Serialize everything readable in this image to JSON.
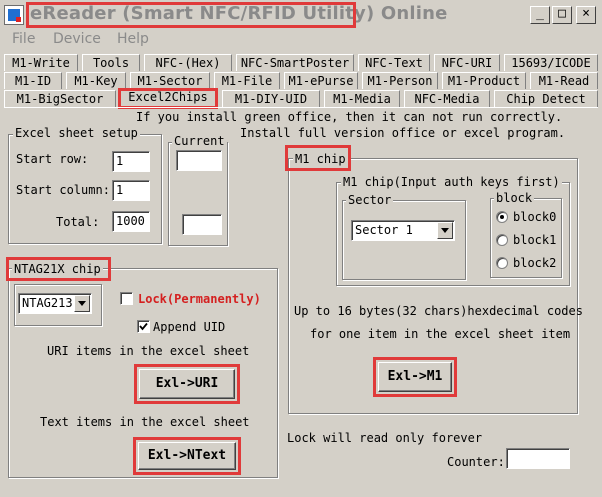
{
  "window": {
    "title": "eReader (Smart NFC/RFID Utility)",
    "title_suffix": " Online",
    "minimize_glyph": "_",
    "maximize_glyph": "□",
    "close_glyph": "×"
  },
  "menu": [
    "File",
    "Device",
    "Help"
  ],
  "tabs": {
    "row1": [
      "M1-Write",
      "Tools",
      "NFC-(Hex)",
      "NFC-SmartPoster",
      "NFC-Text",
      "NFC-URI",
      "15693/ICODE"
    ],
    "row2": [
      "M1-ID",
      "M1-Key",
      "M1-Sector",
      "M1-File",
      "M1-ePurse",
      "M1-Person",
      "M1-Product",
      "M1-Read"
    ],
    "row3": [
      "M1-BigSector",
      "Excel2Chips",
      "M1-DIY-UID",
      "M1-Media",
      "NFC-Media",
      "Chip Detect"
    ]
  },
  "notice": {
    "line1": "If you install green office, then it can not run correctly.",
    "line2": "Install full version office or excel program."
  },
  "excel_setup": {
    "title": "Excel sheet setup",
    "start_row_label": "Start row:",
    "start_row_value": "1",
    "start_column_label": "Start column:",
    "start_column_value": "1",
    "total_label": "Total:",
    "total_value": "1000"
  },
  "current": {
    "title": "Current",
    "value1": "",
    "value2": ""
  },
  "ntag": {
    "title": "NTAG21X chip",
    "chip_type": "NTAG213",
    "lock_label": "Lock(Permanently)",
    "lock_checked": false,
    "append_uid_label": "Append UID",
    "append_uid_checked": true,
    "uri_items_label": "URI items in the excel sheet",
    "exl_uri_button": "Exl->URI",
    "text_items_label": "Text items in the excel sheet",
    "exl_ntext_button": "Exl->NText"
  },
  "m1": {
    "title": "M1 chip",
    "inner_title": "M1 chip(Input auth keys first)",
    "sector_title": "Sector",
    "sector_value": "Sector 1",
    "block_title": "block",
    "blocks": [
      "block0",
      "block1",
      "block2"
    ],
    "selected_block": 0,
    "desc_line1": "Up to 16 bytes(32 chars)hexdecimal codes",
    "desc_line2": "for one item in the excel sheet item",
    "exl_m1_button": "Exl->M1"
  },
  "footer": {
    "lock_note": "Lock will read only forever",
    "counter_label": "Counter:",
    "counter_value": ""
  },
  "colors": {
    "highlight_red": "#e03a3a",
    "lock_red": "#d42020",
    "face": "#d4d0c8"
  }
}
